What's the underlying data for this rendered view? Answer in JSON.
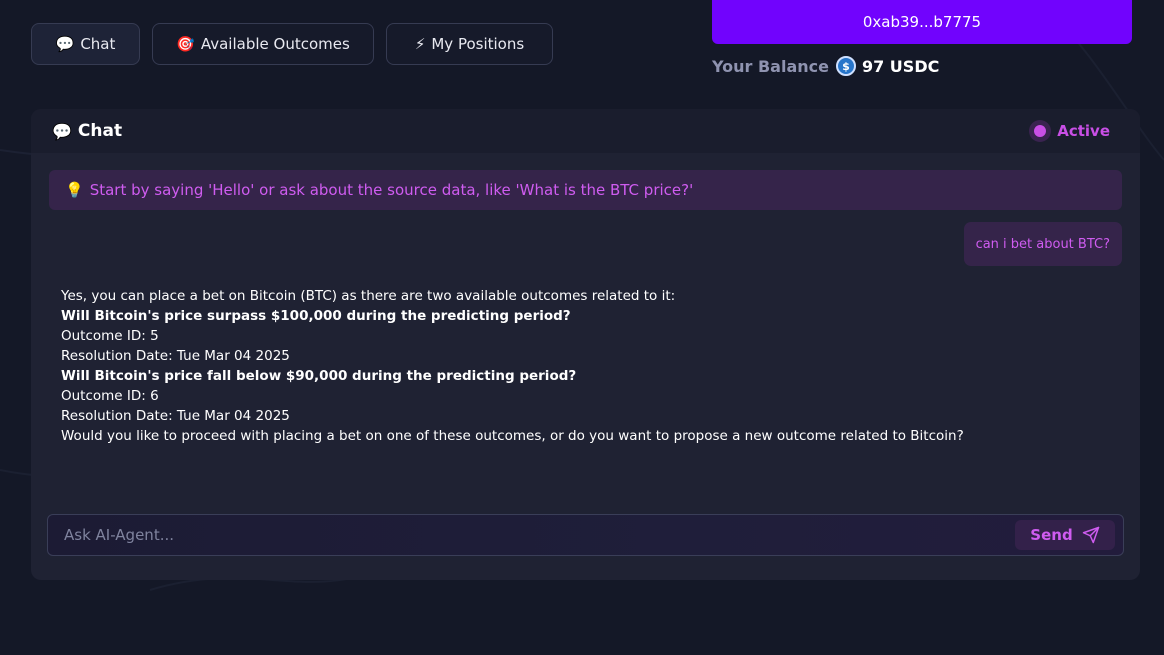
{
  "nav": {
    "tabs": [
      {
        "emoji": "💬",
        "label": "Chat"
      },
      {
        "emoji": "🎯",
        "label": "Available Outcomes"
      },
      {
        "emoji": "⚡",
        "label": "My Positions"
      }
    ]
  },
  "wallet": {
    "address": "0xab39...b7775",
    "balance_label": "Your Balance",
    "balance_value": "97 USDC",
    "token_icon": "usdc-icon"
  },
  "chat": {
    "title_emoji": "💬",
    "title": "Chat",
    "status": "Active",
    "hint_emoji": "💡",
    "hint": "Start by saying 'Hello' or ask about the source data, like 'What is the BTC price?'",
    "user_message": "can i bet about BTC?",
    "agent_lines": [
      "Yes, you can place a bet on Bitcoin (BTC) as there are two available outcomes related to it:",
      "Will Bitcoin's price surpass $100,000 during the predicting period?",
      "Outcome ID: 5",
      "Resolution Date: Tue Mar 04 2025",
      "Will Bitcoin's price fall below $90,000 during the predicting period?",
      "Outcome ID: 6",
      "Resolution Date: Tue Mar 04 2025",
      "Would you like to proceed with placing a bet on one of these outcomes, or do you want to propose a new outcome related to Bitcoin?"
    ],
    "input_placeholder": "Ask AI-Agent...",
    "input_value": "",
    "send_label": "Send"
  },
  "colors": {
    "background": "#141827",
    "accent": "#7103fd",
    "highlight": "#cf5cf0"
  }
}
